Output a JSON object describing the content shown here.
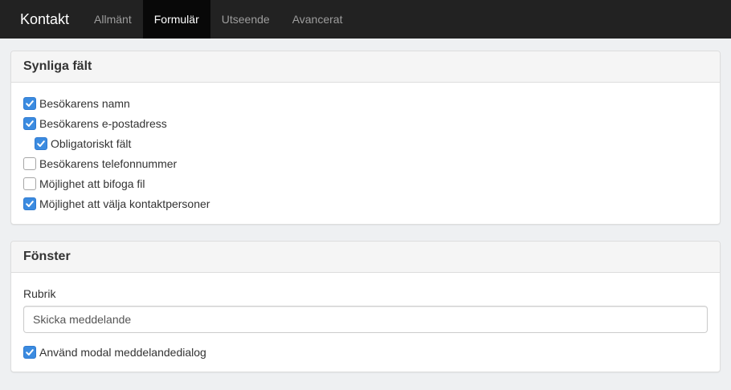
{
  "navbar": {
    "brand": "Kontakt",
    "tabs": [
      {
        "label": "Allmänt",
        "active": false
      },
      {
        "label": "Formulär",
        "active": true
      },
      {
        "label": "Utseende",
        "active": false
      },
      {
        "label": "Avancerat",
        "active": false
      }
    ]
  },
  "visible_fields": {
    "title": "Synliga fält",
    "items": [
      {
        "label": "Besökarens namn",
        "checked": true,
        "indent": false
      },
      {
        "label": "Besökarens e-postadress",
        "checked": true,
        "indent": false
      },
      {
        "label": "Obligatoriskt fält",
        "checked": true,
        "indent": true
      },
      {
        "label": "Besökarens telefonnummer",
        "checked": false,
        "indent": false
      },
      {
        "label": "Möjlighet att bifoga fil",
        "checked": false,
        "indent": false
      },
      {
        "label": "Möjlighet att välja kontaktpersoner",
        "checked": true,
        "indent": false
      }
    ]
  },
  "window": {
    "title": "Fönster",
    "heading_label": "Rubrik",
    "heading_value": "Skicka meddelande",
    "modal_label": "Använd modal meddelandedialog",
    "modal_checked": true
  },
  "colors": {
    "navbar_bg": "#222222",
    "active_tab_bg": "#080808",
    "checkbox_checked": "#3b8be0"
  }
}
